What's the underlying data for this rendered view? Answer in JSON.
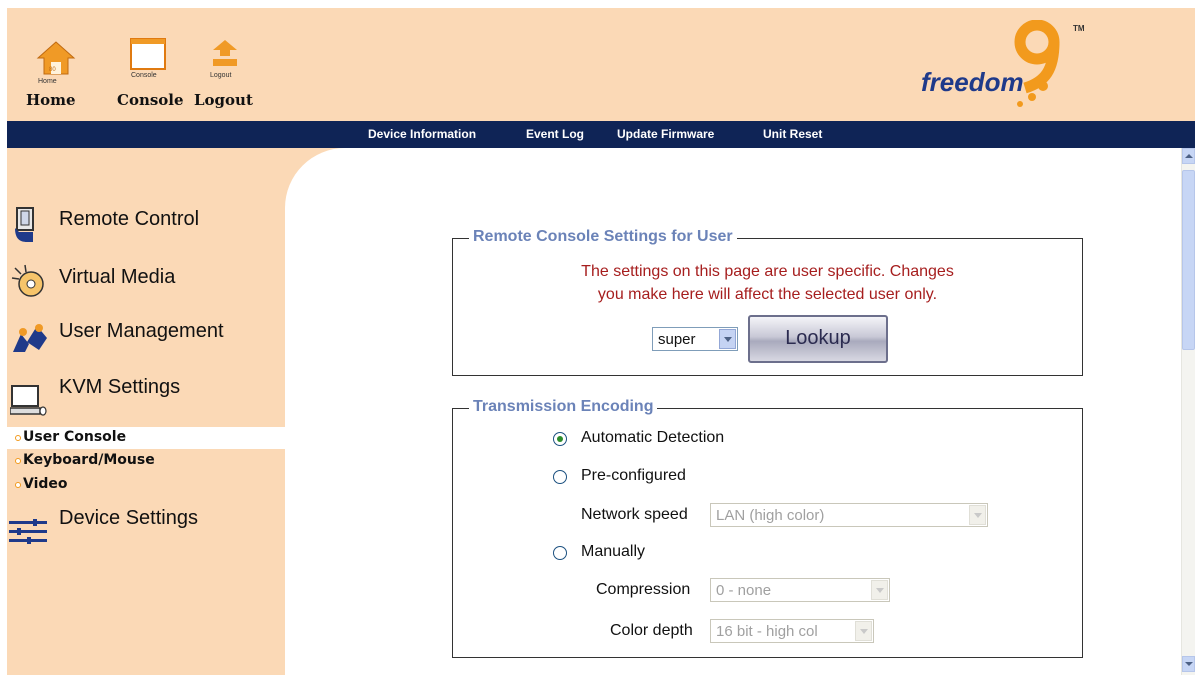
{
  "toolbar": {
    "home": {
      "small_caption": "Home",
      "label": "Home"
    },
    "console": {
      "small_caption": "Console",
      "label": "Console"
    },
    "logout": {
      "small_caption": "Logout",
      "label": "Logout"
    }
  },
  "logo": {
    "text": "freedom",
    "tm": "TM"
  },
  "menu": [
    "Device Information",
    "Event Log",
    "Update Firmware",
    "Unit Reset"
  ],
  "sidebar": {
    "sections": [
      {
        "label": "Remote Control",
        "icon": "hand-icon"
      },
      {
        "label": "Virtual Media",
        "icon": "cd-disc-icon"
      },
      {
        "label": "User Management",
        "icon": "users-icon"
      },
      {
        "label": "KVM Settings",
        "icon": "computer-icon"
      }
    ],
    "subitems": [
      {
        "label": "User Console",
        "active": true
      },
      {
        "label": "Keyboard/Mouse",
        "active": false
      },
      {
        "label": "Video",
        "active": false
      }
    ],
    "device_settings": {
      "label": "Device Settings",
      "icon": "settings-sliders-icon"
    }
  },
  "remote_console": {
    "legend": "Remote Console Settings for User",
    "notice_line1": "The settings on this page are user specific. Changes",
    "notice_line2": "you make here will affect the selected user only.",
    "user_select": "super",
    "lookup_label": "Lookup"
  },
  "encoding": {
    "legend": "Transmission Encoding",
    "options": {
      "auto": "Automatic Detection",
      "preconfigured": "Pre-configured",
      "manual": "Manually"
    },
    "selected": "auto",
    "network_speed_label": "Network speed",
    "network_speed_value": "LAN (high color)",
    "compression_label": "Compression",
    "compression_value": "0 - none",
    "color_depth_label": "Color depth",
    "color_depth_value": "16 bit - high col"
  },
  "colors": {
    "header_bg": "#fbd9b6",
    "menubar_bg": "#0f2456",
    "legend_text": "#6b83b8",
    "notice_text": "#a61e1e",
    "accent_orange": "#f29a1d"
  }
}
